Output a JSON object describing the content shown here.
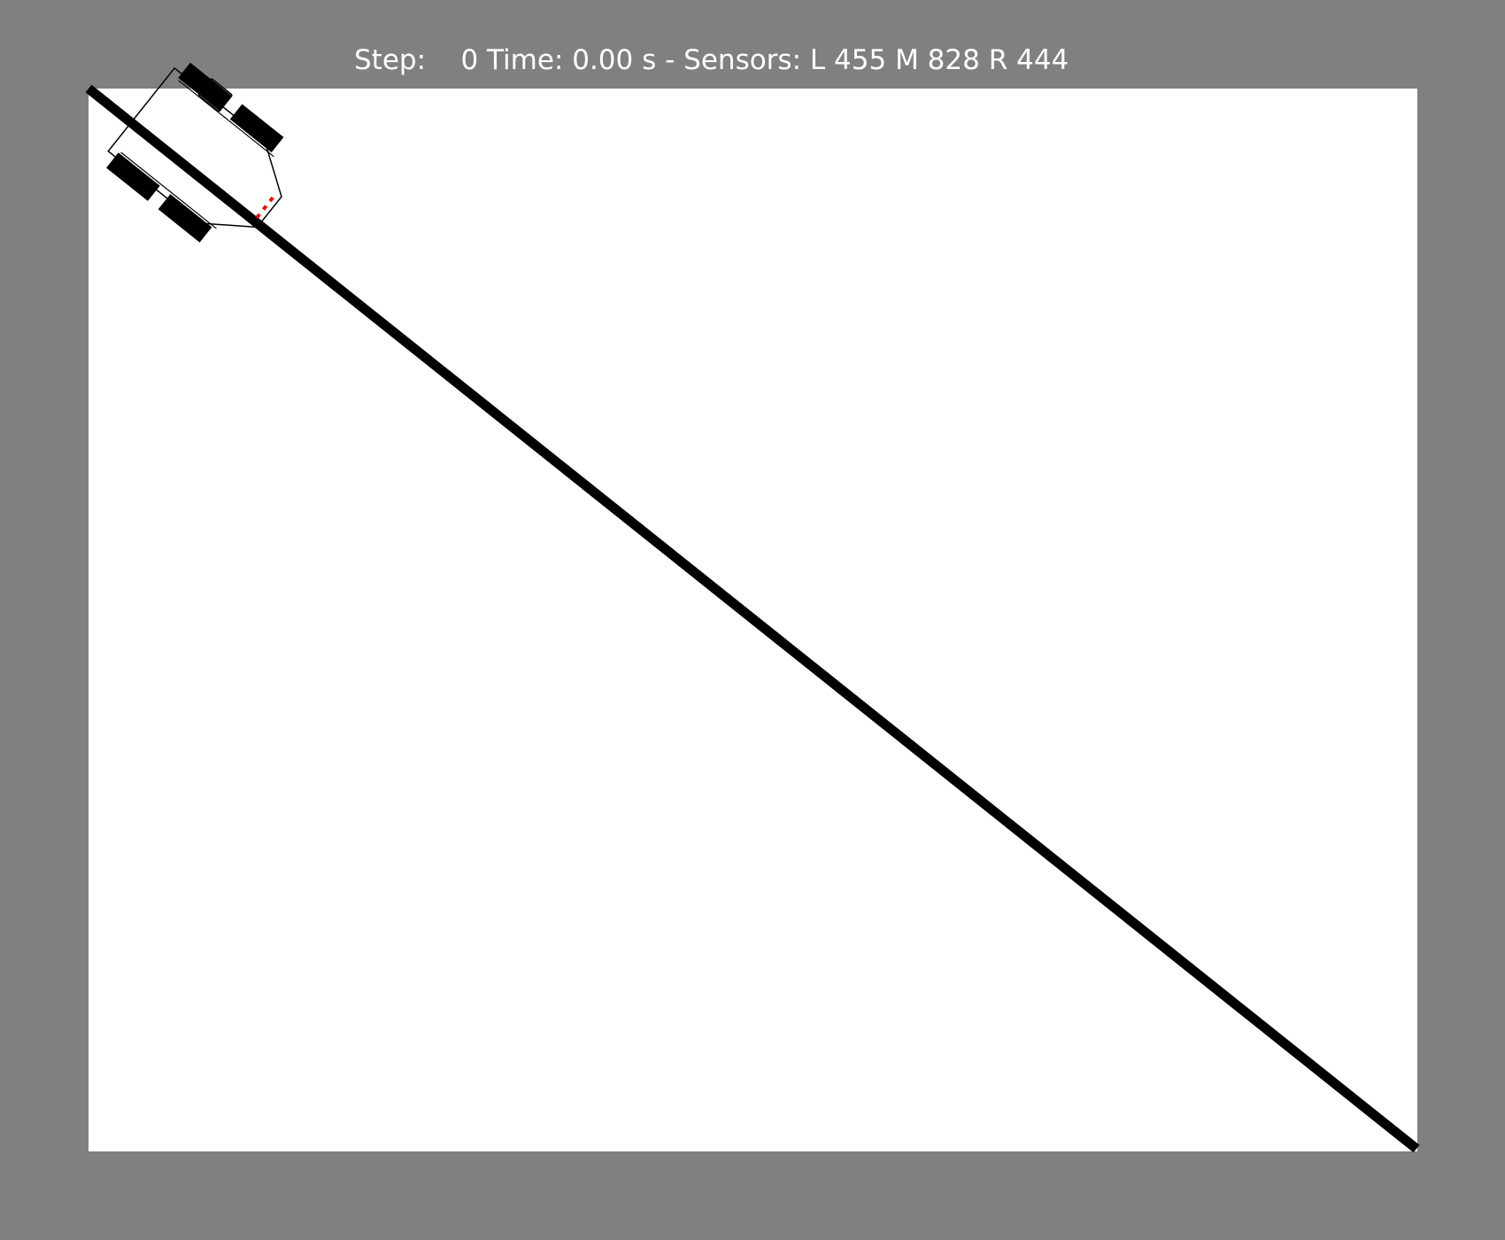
{
  "status": {
    "step_label": "Step:",
    "step_value": "0",
    "time_label": "Time:",
    "time_value": "0.00",
    "time_unit": "s",
    "separator": "-",
    "sensors_label": "Sensors:",
    "left_label": "L",
    "left_value": "455",
    "middle_label": "M",
    "middle_value": "828",
    "right_label": "R",
    "right_value": "444"
  },
  "colors": {
    "background": "#808080",
    "arena": "#ffffff",
    "track_line": "#000000",
    "robot_outline": "#000000",
    "wheel": "#000000",
    "sensor": "#ff0000",
    "status_text": "#ffffff"
  },
  "robot": {
    "icon": "line-follower-robot-icon",
    "wheels": 4,
    "sensors": [
      "left",
      "middle",
      "right"
    ]
  }
}
